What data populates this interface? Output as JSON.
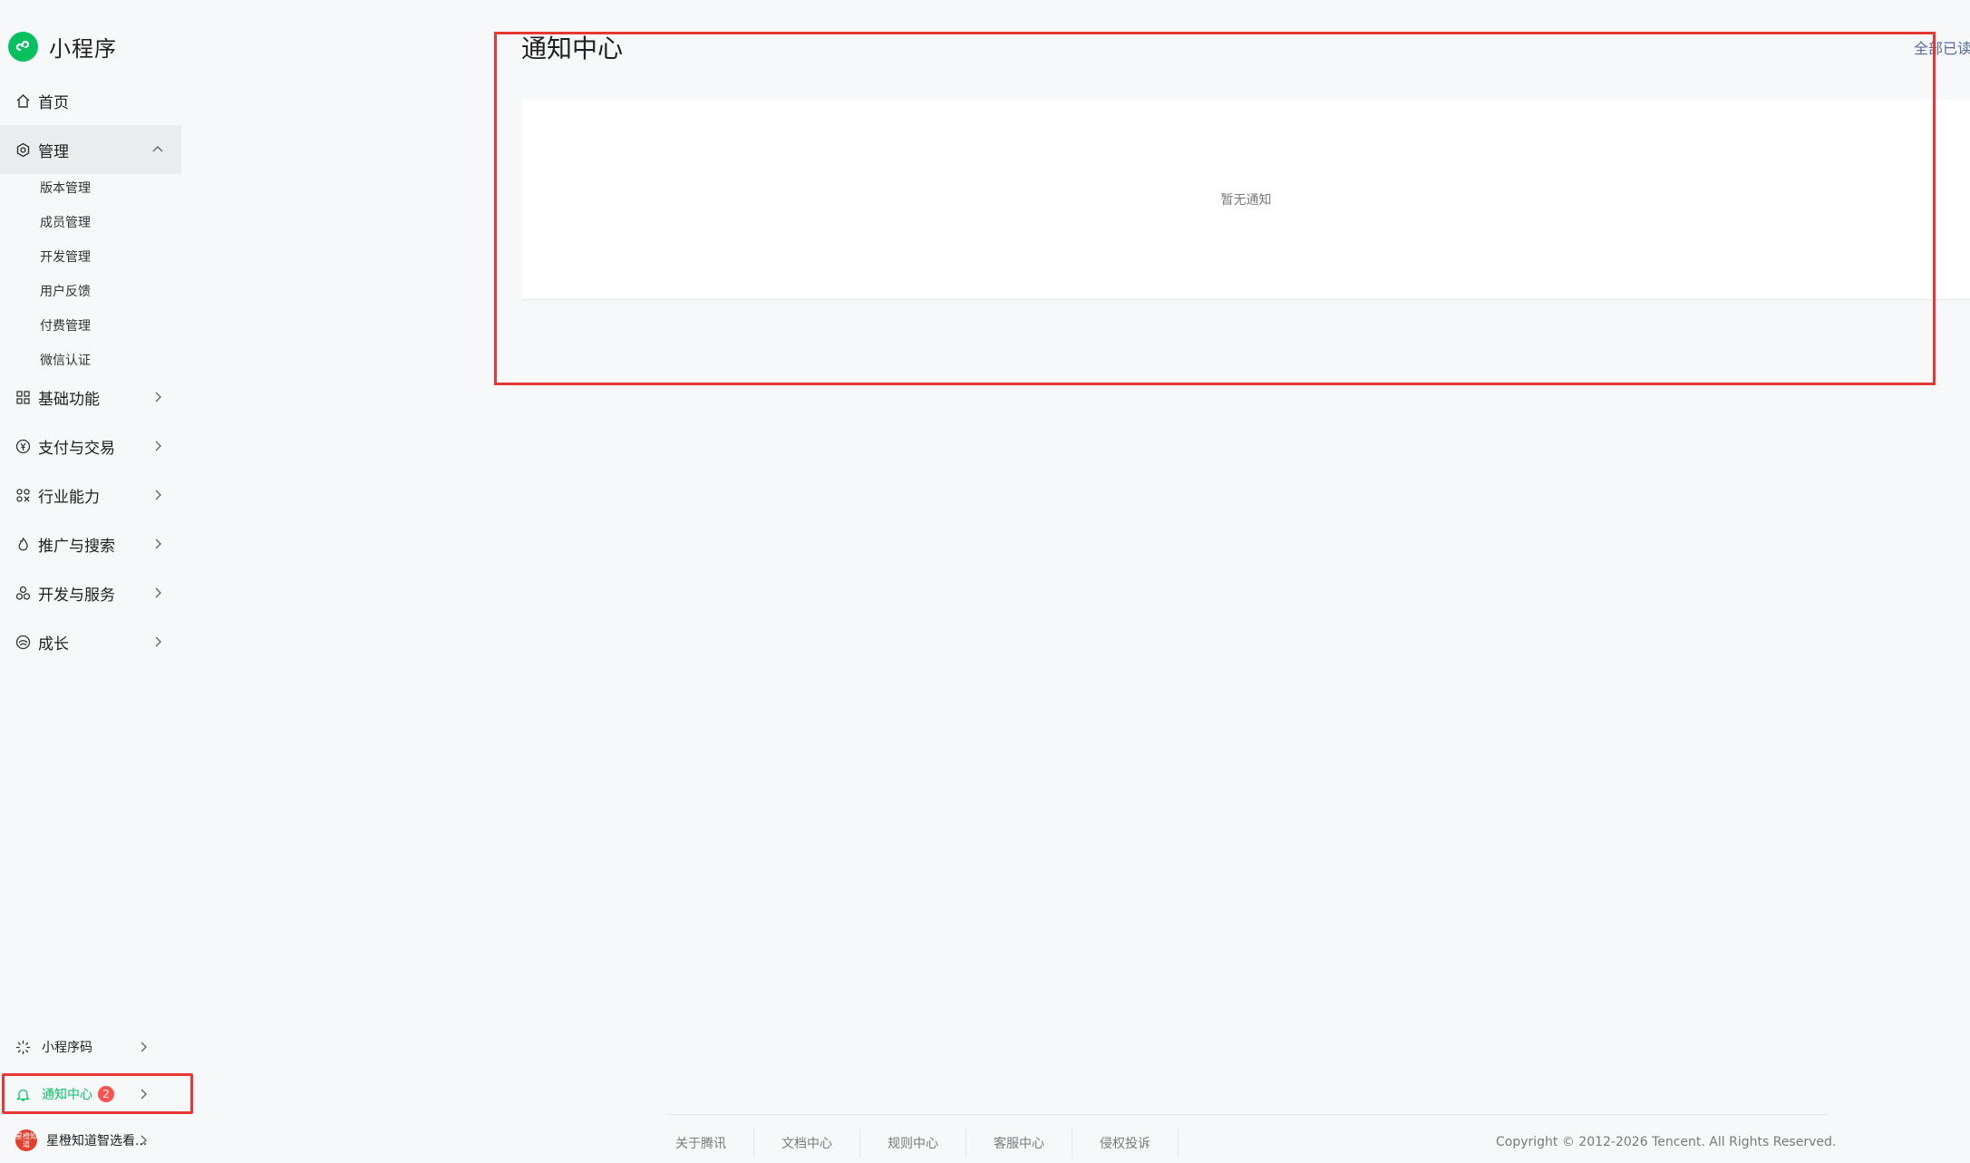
{
  "app": {
    "title": "小程序",
    "accent": "#07c160"
  },
  "sidebar": {
    "items": [
      {
        "label": "首页",
        "icon": "home-icon"
      },
      {
        "label": "管理",
        "icon": "gear-icon",
        "expanded": true,
        "children": [
          "版本管理",
          "成员管理",
          "开发管理",
          "用户反馈",
          "付费管理",
          "微信认证"
        ]
      },
      {
        "label": "基础功能",
        "icon": "grid-icon"
      },
      {
        "label": "支付与交易",
        "icon": "yen-icon"
      },
      {
        "label": "行业能力",
        "icon": "industry-icon"
      },
      {
        "label": "推广与搜索",
        "icon": "promote-icon"
      },
      {
        "label": "开发与服务",
        "icon": "dev-service-icon"
      },
      {
        "label": "成长",
        "icon": "growth-icon"
      }
    ],
    "bottom": {
      "qrcode_label": "小程序码",
      "notifications_label": "通知中心",
      "notifications_count": "2",
      "account_label": "星橙知道智选看...",
      "account_avatar_text": "星橙知道"
    }
  },
  "main": {
    "title": "通知中心",
    "read_all_label": "全部已读",
    "empty_text": "暂无通知"
  },
  "footer": {
    "links": [
      "关于腾讯",
      "文档中心",
      "规则中心",
      "客服中心",
      "侵权投诉"
    ],
    "copyright": "Copyright © 2012-2026 Tencent. All Rights Reserved."
  }
}
